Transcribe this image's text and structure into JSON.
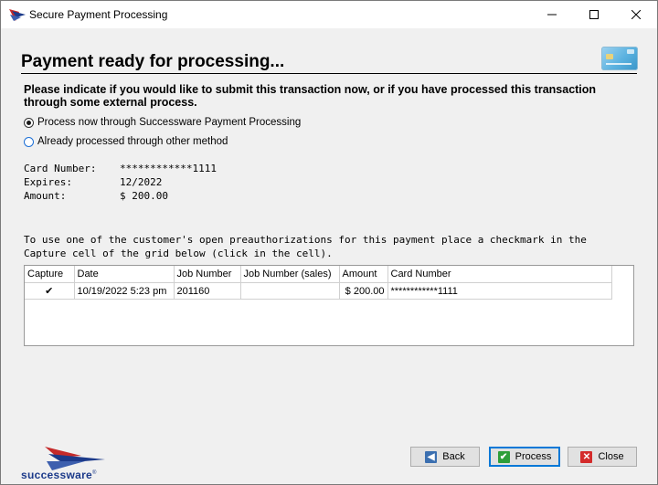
{
  "window": {
    "title": "Secure Payment Processing"
  },
  "header": {
    "heading": "Payment ready for processing..."
  },
  "instructions": "Please indicate if you would like to submit this transaction now, or if you have processed this transaction through some external process.",
  "options": [
    {
      "label": "Process now through Successware Payment Processing",
      "checked": true
    },
    {
      "label": "Already processed through other method",
      "checked": false
    }
  ],
  "payment": {
    "card_number_label": "Card Number:",
    "card_number": "************1111",
    "expires_label": "Expires:",
    "expires": "12/2022",
    "amount_label": "Amount:",
    "amount": "$ 200.00"
  },
  "preauth_text_line1": "To use one of the customer's open preauthorizations for this payment place a checkmark in the",
  "preauth_text_line2": "Capture cell of the grid below (click in the cell).",
  "grid": {
    "columns": [
      "Capture",
      "Date",
      "Job Number",
      "Job Number (sales)",
      "Amount",
      "Card Number"
    ],
    "rows": [
      {
        "capture": "✔",
        "date": "10/19/2022  5:23 pm",
        "job_number": "201160",
        "job_number_sales": "",
        "amount": "$ 200.00",
        "card_number": "************1111"
      }
    ]
  },
  "buttons": {
    "back": "Back",
    "process": "Process",
    "close": "Close"
  },
  "branding": {
    "logo_text": "successware",
    "trademark": "®"
  },
  "colors": {
    "accent": "#0078d7",
    "brand": "#1c3a8a",
    "brand_red": "#d42b2b"
  }
}
